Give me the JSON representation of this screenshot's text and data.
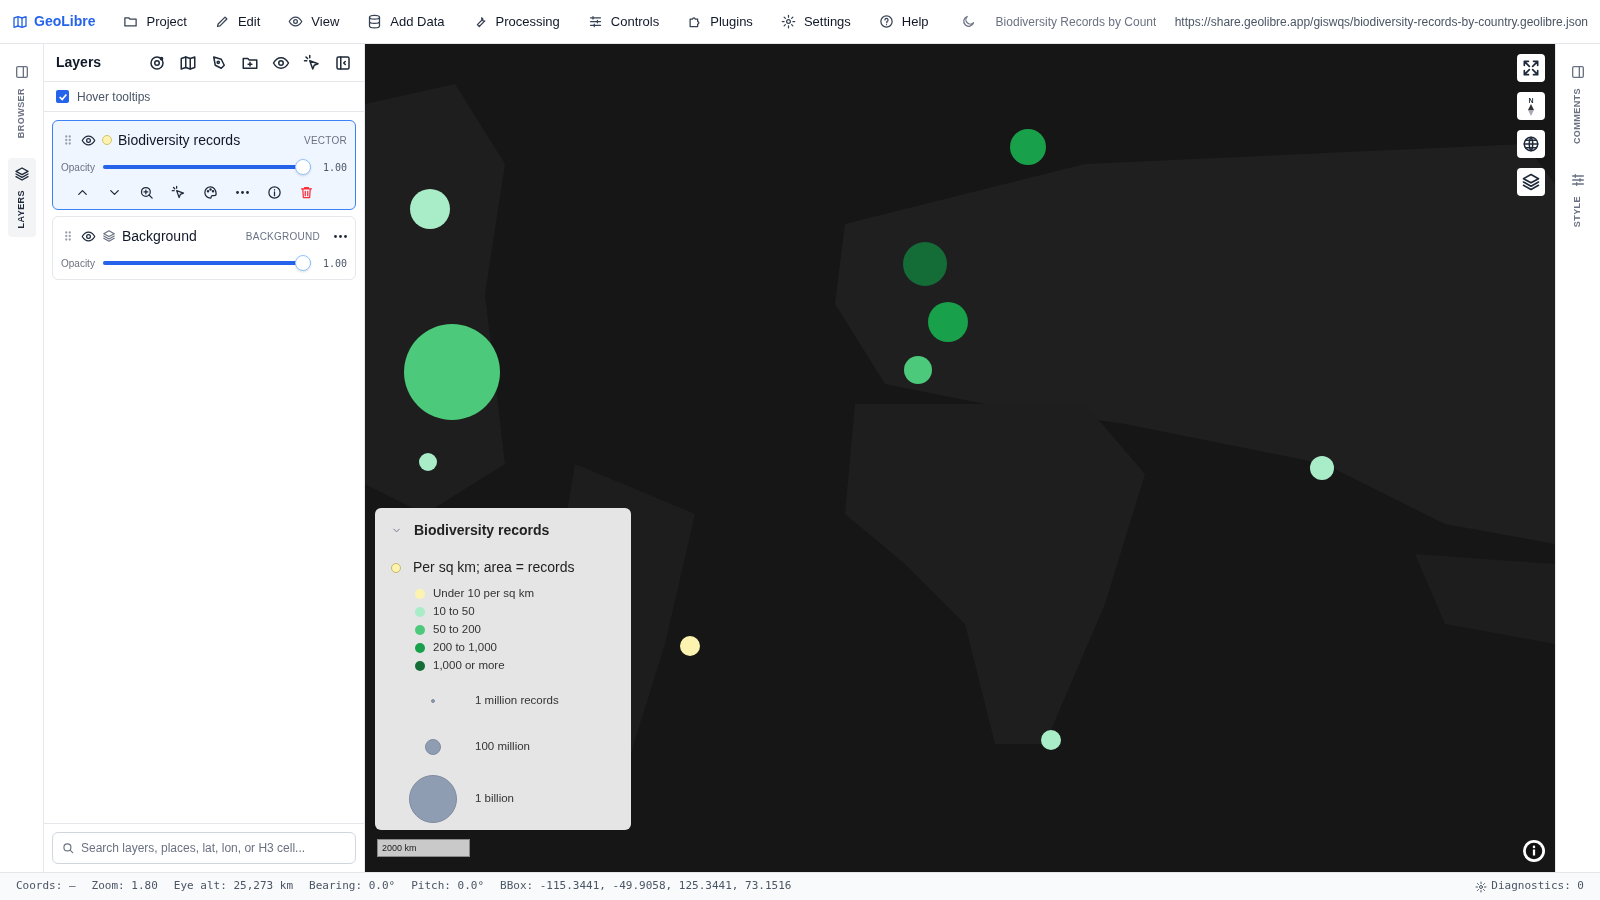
{
  "app": {
    "name": "GeoLibre"
  },
  "menu": [
    {
      "label": "Project"
    },
    {
      "label": "Edit"
    },
    {
      "label": "View"
    },
    {
      "label": "Add Data"
    },
    {
      "label": "Processing"
    },
    {
      "label": "Controls"
    },
    {
      "label": "Plugins"
    },
    {
      "label": "Settings"
    },
    {
      "label": "Help"
    }
  ],
  "project_title": "Biodiversity Records by Count",
  "project_url": "https://share.geolibre.app/giswqs/biodiversity-records-by-country.geolibre.json",
  "left_rail": [
    {
      "label": "BROWSER",
      "selected": false
    },
    {
      "label": "LAYERS",
      "selected": true
    }
  ],
  "right_rail": [
    {
      "label": "COMMENTS"
    },
    {
      "label": "STYLE"
    }
  ],
  "layers_panel": {
    "title": "Layers",
    "hover_tooltips": {
      "label": "Hover tooltips",
      "checked": true
    },
    "layers": [
      {
        "kind": "vector",
        "name": "Biodiversity records",
        "type": "VECTOR",
        "visible": true,
        "selected": true,
        "expanded": true,
        "color": "#fdf3b0",
        "opacity_label": "Opacity",
        "level": 1.0,
        "reading": "1.00"
      },
      {
        "kind": "background",
        "name": "Background",
        "type": "BACKGROUND",
        "visible": true,
        "selected": false,
        "expanded": false,
        "opacity_label": "Opacity",
        "level": 1.0,
        "reading": "1.00"
      }
    ],
    "search": {
      "placeholder": "Search layers, places, lat, lon, or H3 cell..."
    }
  },
  "map": {
    "kind": "picture",
    "compass_label": "N",
    "scale": "2000 km"
  },
  "legend": {
    "title": "Biodiversity records",
    "expanded": true,
    "subtitle": "Per sq km; area = records",
    "classes": [
      {
        "label": "Under 10 per sq km",
        "color": "#fdf3b0"
      },
      {
        "label": "10 to 50",
        "color": "#a9ecc8"
      },
      {
        "label": "50 to 200",
        "color": "#4cc97a"
      },
      {
        "label": "200 to 1,000",
        "color": "#18a04a"
      },
      {
        "label": "1,000 or more",
        "color": "#146c36"
      }
    ],
    "sizes": [
      {
        "label": "1 million records"
      },
      {
        "label": "100 million"
      },
      {
        "label": "1 billion"
      }
    ]
  },
  "status_bar": [
    "Coords: —",
    "Zoom: 1.80",
    "Eye alt: 25,273 km",
    "Bearing: 0.0°",
    "Pitch: 0.0°",
    "BBox: -115.3441, -49.9058, 125.3441, 73.1516"
  ],
  "diagnostics": "Diagnostics: 0"
}
